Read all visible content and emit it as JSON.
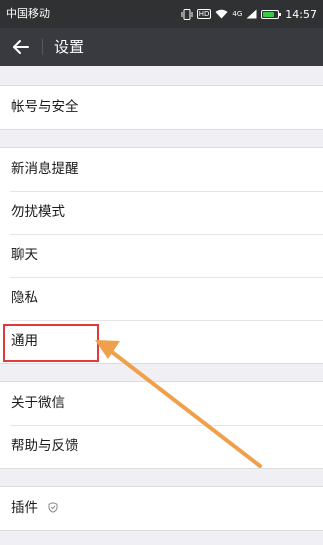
{
  "status_bar": {
    "carrier": "中国移动",
    "hd_badge": "HD",
    "network_badge": "4G",
    "time": "14:57",
    "battery_color": "#33cc44",
    "battery_level": 0.75
  },
  "header": {
    "title": "设置",
    "back_icon": "back-arrow-icon"
  },
  "groups": [
    {
      "items": [
        {
          "label": "帐号与安全"
        }
      ]
    },
    {
      "items": [
        {
          "label": "新消息提醒"
        },
        {
          "label": "勿扰模式"
        },
        {
          "label": "聊天"
        },
        {
          "label": "隐私"
        },
        {
          "label": "通用"
        }
      ]
    },
    {
      "items": [
        {
          "label": "关于微信"
        },
        {
          "label": "帮助与反馈"
        }
      ]
    },
    {
      "items": [
        {
          "label": "插件",
          "icon": "shield-icon"
        }
      ]
    }
  ],
  "annotation": {
    "highlight_color": "#e23a3a",
    "arrow_color": "#f0a04b"
  }
}
